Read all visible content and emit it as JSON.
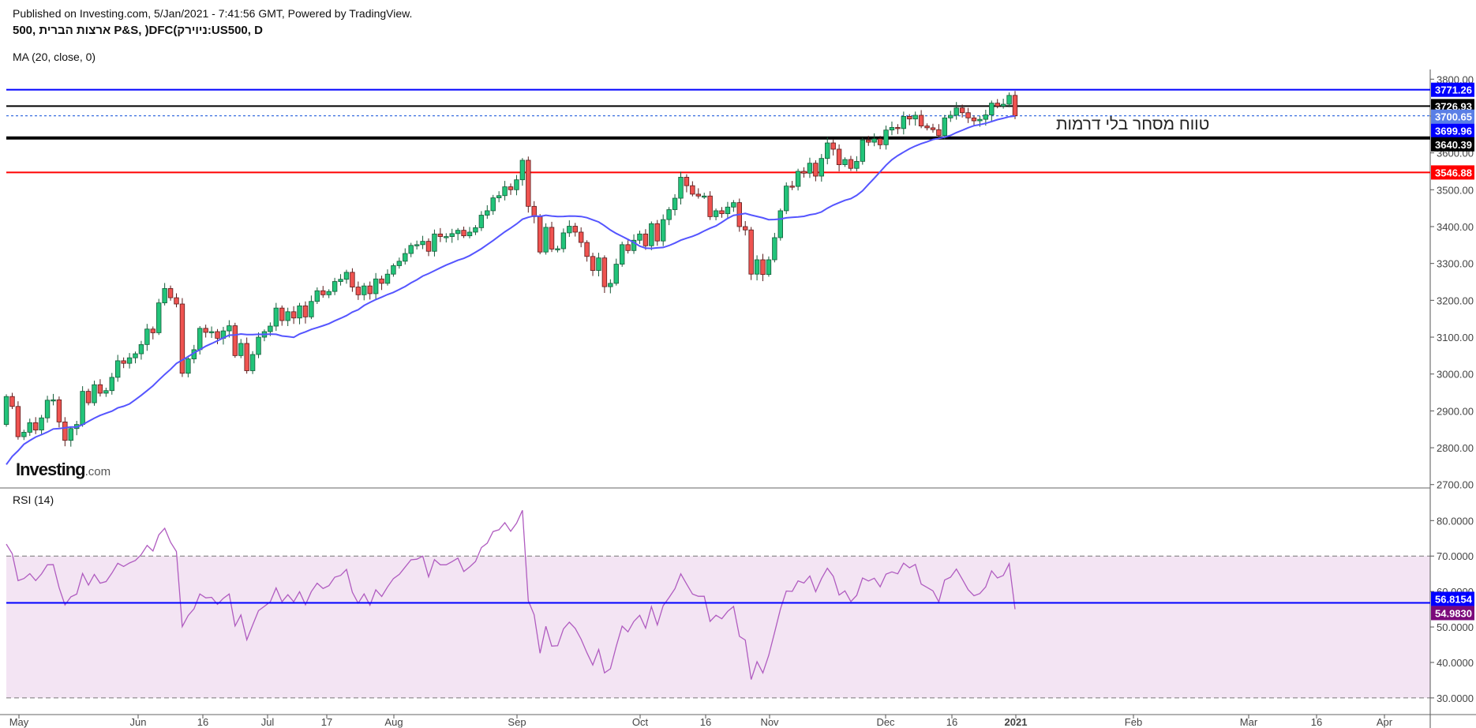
{
  "header": {
    "published": "Published on Investing.com, 5/Jan/2021 - 7:41:56 GMT, Powered by TradingView.",
    "title": "ארצות הברית ,500 P&S, )DFC(ניוירק:US500, D",
    "ma_label": "MA (20, close, 0)",
    "rsi_label": "RSI (14)"
  },
  "logo": {
    "main": "Investing",
    "suffix": ".com"
  },
  "annotation": "טווח מסחר בלי דרמות",
  "chart_data": [
    {
      "type": "candlestick",
      "symbol": "US500",
      "interval": "D",
      "x_range": [
        "2020-04-29",
        "2021-01-04"
      ],
      "ylim": [
        2700,
        3800
      ],
      "y_ticks": [
        "3800.00",
        "3700.00",
        "3600.00",
        "3500.00",
        "3400.00",
        "3300.00",
        "3200.00",
        "3100.00",
        "3000.00",
        "2900.00",
        "2800.00",
        "2700.00"
      ],
      "x_ticks": [
        "May",
        "Jun",
        "16",
        "Jul",
        "17",
        "Aug",
        "Sep",
        "Oct",
        "16",
        "Nov",
        "Dec",
        "16",
        "2021",
        "Feb",
        "Mar",
        "16",
        "Apr"
      ],
      "close": [
        2939,
        2912,
        2830,
        2842,
        2868,
        2848,
        2881,
        2929,
        2930,
        2870,
        2820,
        2852,
        2863,
        2953,
        2922,
        2971,
        2948,
        2955,
        2991,
        3036,
        3029,
        3044,
        3055,
        3080,
        3122,
        3112,
        3193,
        3232,
        3207,
        3190,
        3002,
        3041,
        3066,
        3124,
        3113,
        3115,
        3097,
        3117,
        3131,
        3050,
        3083,
        3009,
        3053,
        3100,
        3115,
        3130,
        3179,
        3145,
        3169,
        3152,
        3185,
        3155,
        3197,
        3226,
        3215,
        3224,
        3251,
        3257,
        3276,
        3236,
        3215,
        3239,
        3218,
        3258,
        3246,
        3271,
        3294,
        3306,
        3327,
        3349,
        3351,
        3360,
        3333,
        3380,
        3373,
        3373,
        3381,
        3390,
        3375,
        3385,
        3397,
        3431,
        3443,
        3478,
        3484,
        3508,
        3500,
        3527,
        3580,
        3455,
        3427,
        3331,
        3398,
        3339,
        3340,
        3383,
        3401,
        3385,
        3357,
        3319,
        3281,
        3315,
        3237,
        3246,
        3298,
        3351,
        3335,
        3363,
        3380,
        3348,
        3408,
        3361,
        3419,
        3446,
        3477,
        3534,
        3511,
        3488,
        3483,
        3483,
        3427,
        3443,
        3435,
        3453,
        3465,
        3400,
        3391,
        3271,
        3310,
        3270,
        3310,
        3370,
        3443,
        3510,
        3509,
        3550,
        3545,
        3572,
        3537,
        3585,
        3627,
        3610,
        3568,
        3582,
        3558,
        3577,
        3635,
        3629,
        3638,
        3622,
        3662,
        3669,
        3666,
        3699,
        3692,
        3702,
        3673,
        3668,
        3663,
        3647,
        3695,
        3702,
        3722,
        3709,
        3695,
        3687,
        3691,
        3703,
        3735,
        3727,
        3732,
        3756,
        3700.65
      ],
      "moving_average": {
        "period": 20,
        "source": "close",
        "color": "#5555ff",
        "last_value": "3699.96"
      },
      "horizontal_lines": [
        {
          "value": 3771.26,
          "label": "3771.26",
          "color": "#0000ff",
          "style": "solid"
        },
        {
          "value": 3726.93,
          "label": "3726.93",
          "color": "#000000",
          "style": "solid"
        },
        {
          "value": 3700.65,
          "label": "3700.65",
          "color": "#3a6fe0",
          "style": "dotted",
          "note": "last price"
        },
        {
          "value": 3640.39,
          "label": "3640.39",
          "color": "#000000",
          "style": "thick"
        },
        {
          "value": 3546.88,
          "label": "3546.88",
          "color": "#ff0000",
          "style": "solid"
        }
      ],
      "colors": {
        "up": "#22c47a",
        "down": "#ef5350"
      }
    },
    {
      "type": "line",
      "indicator": "RSI (14)",
      "ylim": [
        30,
        80
      ],
      "y_ticks": [
        "80.0000",
        "70.0000",
        "60.0000",
        "50.0000",
        "40.0000",
        "30.0000"
      ],
      "band": [
        30,
        70
      ],
      "last_value": "54.9830",
      "horizontal_line": {
        "value": 56.8154,
        "label": "56.8154",
        "color": "#0000ff"
      },
      "colors": {
        "line": "#b05cc0",
        "band": "#f3e4f3",
        "last_label": "#7b0a7b"
      }
    }
  ]
}
